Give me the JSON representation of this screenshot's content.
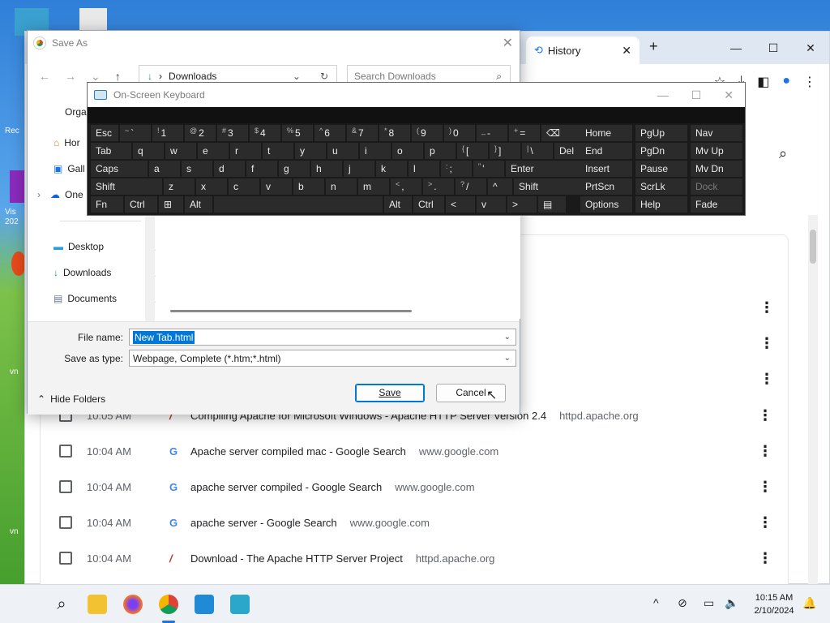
{
  "desktop": {
    "labels": [
      "Rec",
      "Vis",
      "202",
      "vn",
      "vn"
    ]
  },
  "chrome": {
    "tab_title": "History",
    "tab_close": "✕",
    "new_tab": "+",
    "win_min": "—",
    "win_max": "☐",
    "win_close": "✕",
    "history_rows": [
      {
        "time": "10:05 AM",
        "favicon": "apache",
        "title": "Compiling Apache for Microsoft Windows - Apache HTTP Server Version 2.4",
        "domain": "httpd.apache.org"
      },
      {
        "time": "10:04 AM",
        "favicon": "google",
        "title": "Apache server compiled mac - Google Search",
        "domain": "www.google.com"
      },
      {
        "time": "10:04 AM",
        "favicon": "google",
        "title": "apache server compiled - Google Search",
        "domain": "www.google.com"
      },
      {
        "time": "10:04 AM",
        "favicon": "google",
        "title": "apache server - Google Search",
        "domain": "www.google.com"
      },
      {
        "time": "10:04 AM",
        "favicon": "apache",
        "title": "Download - The Apache HTTP Server Project",
        "domain": "httpd.apache.org"
      }
    ],
    "google_favicon_glyph": "G",
    "apache_favicon_glyph": "/",
    "more_glyph": "⋮"
  },
  "saveas": {
    "title": "Save As",
    "close_glyph": "✕",
    "address": "Downloads",
    "search_placeholder": "Search Downloads",
    "organize": "Organize ▾",
    "sidebar": [
      {
        "label": "Hor",
        "icon": "home-icon"
      },
      {
        "label": "Gall",
        "icon": "gallery-icon"
      },
      {
        "label": "One",
        "icon": "onedrive-icon"
      }
    ],
    "quick_access": [
      {
        "label": "Desktop",
        "icon": "desktop-icon"
      },
      {
        "label": "Downloads",
        "icon": "downloads-icon"
      },
      {
        "label": "Documents",
        "icon": "documents-icon"
      }
    ],
    "file_name_label": "File name:",
    "file_name_value": "New Tab.html",
    "save_type_label": "Save as type:",
    "save_type_value": "Webpage, Complete (*.htm;*.html)",
    "hide_folders": "Hide Folders",
    "save_button": "Save",
    "cancel_button": "Cancel"
  },
  "osk": {
    "title": "On-Screen Keyboard",
    "rows": [
      [
        {
          "label": "Esc",
          "w": 34
        },
        {
          "sup": "~",
          "label": "`",
          "w": 38
        },
        {
          "sup": "!",
          "label": "1",
          "w": 38
        },
        {
          "sup": "@",
          "label": "2",
          "w": 38
        },
        {
          "sup": "#",
          "label": "3",
          "w": 38
        },
        {
          "sup": "$",
          "label": "4",
          "w": 38
        },
        {
          "sup": "%",
          "label": "5",
          "w": 38
        },
        {
          "sup": "^",
          "label": "6",
          "w": 38
        },
        {
          "sup": "&",
          "label": "7",
          "w": 38
        },
        {
          "sup": "*",
          "label": "8",
          "w": 38
        },
        {
          "sup": "(",
          "label": "9",
          "w": 38
        },
        {
          "sup": ")",
          "label": "0",
          "w": 38
        },
        {
          "sup": "_",
          "label": "-",
          "w": 38
        },
        {
          "sup": "+",
          "label": "=",
          "w": 38
        },
        {
          "label": "⌫",
          "w": 66
        }
      ],
      [
        {
          "label": "Tab",
          "w": 50
        },
        {
          "label": "q",
          "w": 38
        },
        {
          "label": "w",
          "w": 38
        },
        {
          "label": "e",
          "w": 38
        },
        {
          "label": "r",
          "w": 38
        },
        {
          "label": "t",
          "w": 38
        },
        {
          "label": "y",
          "w": 38
        },
        {
          "label": "u",
          "w": 38
        },
        {
          "label": "i",
          "w": 38
        },
        {
          "label": "o",
          "w": 38
        },
        {
          "label": "p",
          "w": 38
        },
        {
          "sup": "{",
          "label": "[",
          "w": 38
        },
        {
          "sup": "}",
          "label": "]",
          "w": 38
        },
        {
          "sup": "|",
          "label": "\\",
          "w": 38
        },
        {
          "label": "Del",
          "w": 50
        }
      ],
      [
        {
          "label": "Caps",
          "w": 70
        },
        {
          "label": "a",
          "w": 38
        },
        {
          "label": "s",
          "w": 38
        },
        {
          "label": "d",
          "w": 38
        },
        {
          "label": "f",
          "w": 38
        },
        {
          "label": "g",
          "w": 38
        },
        {
          "label": "h",
          "w": 38
        },
        {
          "label": "j",
          "w": 38
        },
        {
          "label": "k",
          "w": 38
        },
        {
          "label": "l",
          "w": 38
        },
        {
          "sup": ":",
          "label": ";",
          "w": 38
        },
        {
          "sup": "\"",
          "label": "'",
          "w": 38
        },
        {
          "label": "Enter",
          "w": 108
        }
      ],
      [
        {
          "label": "Shift",
          "w": 88
        },
        {
          "label": "z",
          "w": 38
        },
        {
          "label": "x",
          "w": 38
        },
        {
          "label": "c",
          "w": 38
        },
        {
          "label": "v",
          "w": 38
        },
        {
          "label": "b",
          "w": 38
        },
        {
          "label": "n",
          "w": 38
        },
        {
          "label": "m",
          "w": 38
        },
        {
          "sup": "<",
          "label": ",",
          "w": 38
        },
        {
          "sup": ">",
          "label": ".",
          "w": 38
        },
        {
          "sup": "?",
          "label": "/",
          "w": 38
        },
        {
          "label": "^",
          "w": 30
        },
        {
          "label": "Shift",
          "w": 82
        }
      ],
      [
        {
          "label": "Fn",
          "w": 40
        },
        {
          "label": "Ctrl",
          "w": 40
        },
        {
          "label": "⊞",
          "w": 30
        },
        {
          "label": "Alt",
          "w": 34
        },
        {
          "label": "",
          "w": 208
        },
        {
          "label": "Alt",
          "w": 34
        },
        {
          "label": "Ctrl",
          "w": 38
        },
        {
          "label": "<",
          "w": 36
        },
        {
          "label": "v",
          "w": 36
        },
        {
          "label": ">",
          "w": 36
        },
        {
          "label": "▤",
          "w": 34
        }
      ]
    ],
    "nav_keys": [
      [
        "Home",
        "PgUp",
        "Nav"
      ],
      [
        "End",
        "PgDn",
        "Mv Up"
      ],
      [
        "Insert",
        "Pause",
        "Mv Dn"
      ],
      [
        "PrtScn",
        "ScrLk",
        "Dock"
      ],
      [
        "Options",
        "Help",
        "Fade"
      ]
    ]
  },
  "taskbar": {
    "time": "10:15 AM",
    "date": "2/10/2024",
    "tray_chevron": "^"
  }
}
